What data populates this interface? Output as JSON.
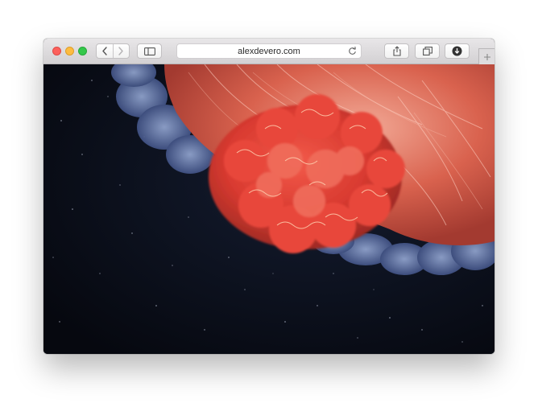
{
  "browser": {
    "url": "alexdevero.com",
    "icons": {
      "close": "close-traffic-light",
      "minimize": "minimize-traffic-light",
      "maximize": "maximize-traffic-light",
      "back": "chevron-left-icon",
      "forward": "chevron-right-icon",
      "sidebar": "sidebar-icon",
      "reload": "reload-icon",
      "share": "share-icon",
      "tabs": "tabs-icon",
      "downloads": "download-icon",
      "new_tab": "plus-icon"
    },
    "colors": {
      "close": "#fc605c",
      "minimize": "#fdbc40",
      "maximize": "#34c84a"
    }
  },
  "page": {
    "hero_image": "jellyfish-photo"
  }
}
